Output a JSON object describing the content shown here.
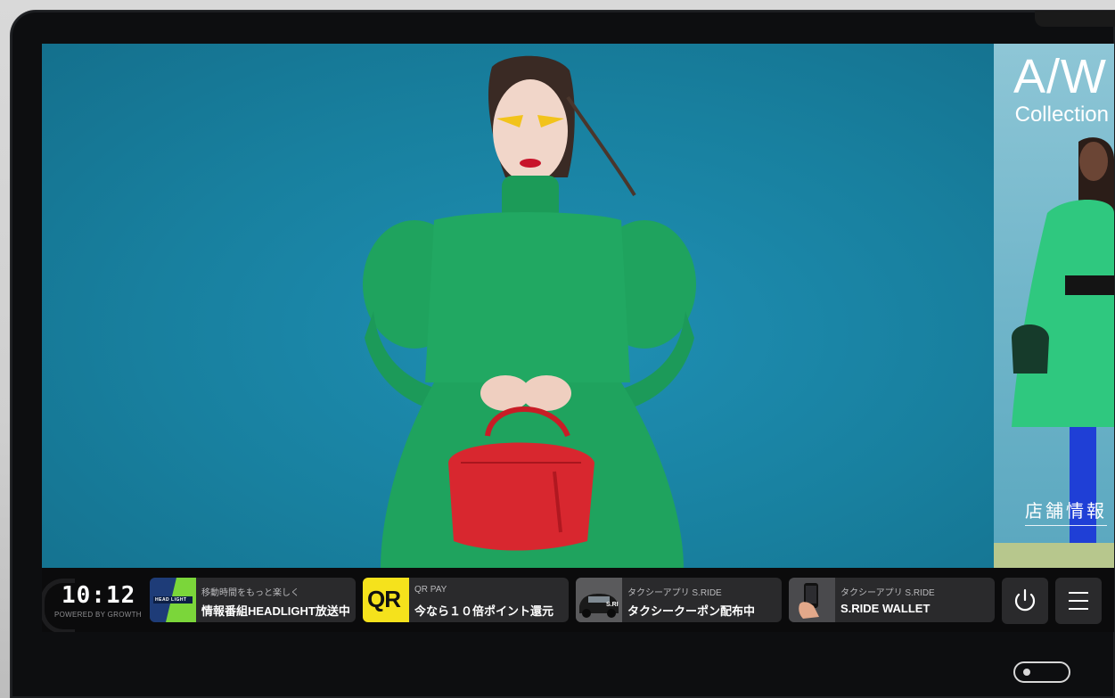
{
  "side_ad": {
    "title": "A/W",
    "subtitle": "Collection",
    "store_link": "店舗情報"
  },
  "clock": {
    "time": "10:12",
    "powered": "POWERED BY GROWTH"
  },
  "tiles": [
    {
      "thumb_text": "HEAD LIGHT",
      "subtitle": "移動時間をもっと楽しく",
      "title": "情報番組HEADLIGHT放送中"
    },
    {
      "thumb_text": "QR",
      "subtitle": "QR PAY",
      "title": "今なら１０倍ポイント還元"
    },
    {
      "thumb_text": "S.RI",
      "subtitle": "タクシーアプリ S.RIDE",
      "title": "タクシークーポン配布中"
    },
    {
      "subtitle": "タクシーアプリ S.RIDE",
      "title": "S.RIDE WALLET"
    }
  ],
  "buttons": {
    "power_icon": "power-icon",
    "menu_icon": "hamburger-menu-icon"
  },
  "colors": {
    "ad_background": "#1a87a9",
    "dress_green": "#1fa35e",
    "bag_red": "#d8272f",
    "taskbar": "#0b0b0c",
    "tile_bg": "#2a2a2c",
    "qr_yellow": "#f5e21c"
  }
}
